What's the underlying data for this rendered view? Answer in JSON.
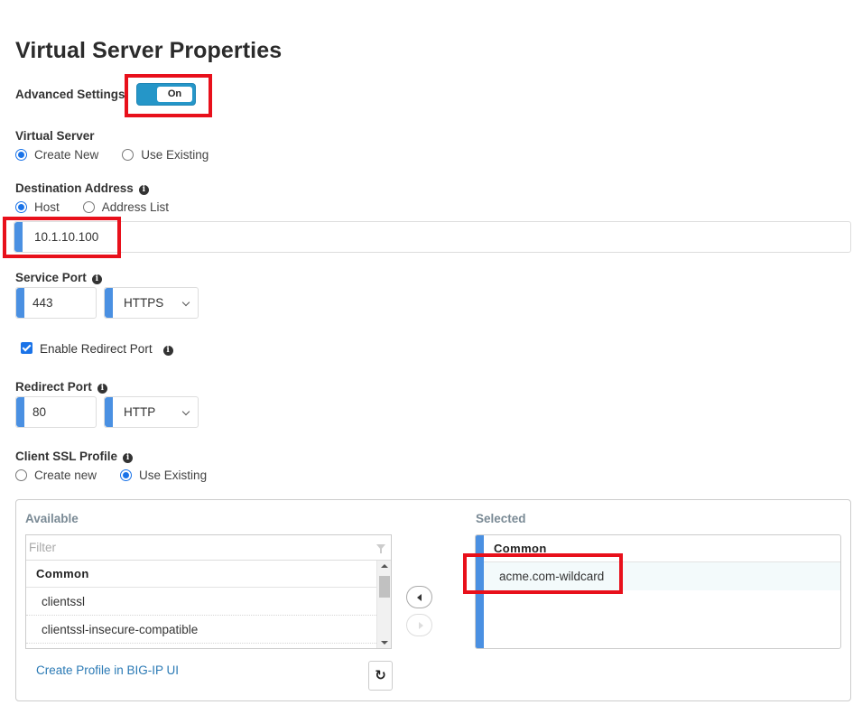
{
  "page_title": "Virtual Server Properties",
  "advanced_settings": {
    "label": "Advanced Settings",
    "toggle_text": "On"
  },
  "virtual_server": {
    "label": "Virtual Server",
    "options": [
      "Create New",
      "Use Existing"
    ],
    "selected": "Create New"
  },
  "destination": {
    "label": "Destination Address",
    "info_icon": "i",
    "options": [
      "Host",
      "Address List"
    ],
    "selected": "Host",
    "value": "10.1.10.100"
  },
  "service_port": {
    "label": "Service Port",
    "info_icon": "i",
    "value": "443",
    "protocol": "HTTPS"
  },
  "redirect": {
    "checkbox_label": "Enable Redirect Port",
    "checked": true,
    "info_icon": "i"
  },
  "redirect_port": {
    "label": "Redirect Port",
    "info_icon": "i",
    "value": "80",
    "protocol": "HTTP"
  },
  "client_ssl": {
    "label": "Client SSL Profile",
    "info_icon": "i",
    "options": [
      "Create new",
      "Use Existing"
    ],
    "selected": "Use Existing"
  },
  "profile_picker": {
    "available_label": "Available",
    "filter_placeholder": "Filter",
    "available_group": "Common",
    "available_items": [
      "clientssl",
      "clientssl-insecure-compatible"
    ],
    "selected_label": "Selected",
    "selected_group": "Common",
    "selected_items": [
      "acme.com-wildcard"
    ],
    "create_link": "Create Profile in BIG-IP UI",
    "refresh_icon": "↻"
  },
  "colors": {
    "accent": "#4a90e2",
    "toggle": "#2596c8",
    "highlight": "#e8101b",
    "link": "#2b7ab5"
  }
}
